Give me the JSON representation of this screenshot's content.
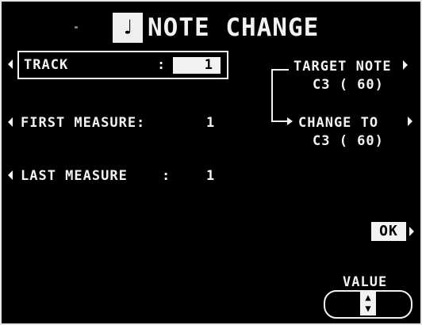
{
  "header": {
    "note_icon": "♩",
    "title": "NOTE CHANGE"
  },
  "track": {
    "label": "TRACK",
    "separator": ":",
    "value": "1"
  },
  "first_measure": {
    "label": "FIRST MEASURE:",
    "value": "1"
  },
  "last_measure": {
    "label": "LAST MEASURE",
    "separator": ":",
    "value": "1"
  },
  "target_note": {
    "label": "TARGET NOTE",
    "value": "C3 ( 60)"
  },
  "change_to": {
    "label": "CHANGE TO",
    "value": "C3 ( 60)"
  },
  "ok_button": {
    "label": "OK"
  },
  "value_control": {
    "label": "VALUE",
    "up": "▲",
    "down": "▼"
  },
  "colors": {
    "background": "#000000",
    "foreground": "#f2f2f2"
  }
}
